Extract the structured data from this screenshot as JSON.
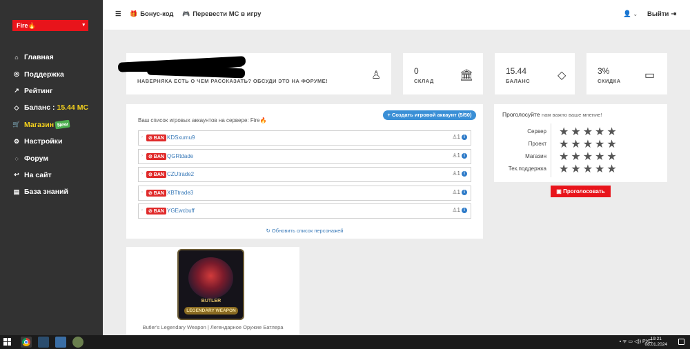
{
  "sidebar": {
    "server": "Fire🔥",
    "items": [
      {
        "icon": "home-icon",
        "glyph": "⌂",
        "label": "Главная"
      },
      {
        "icon": "support-icon",
        "glyph": "◎",
        "label": "Поддержка"
      },
      {
        "icon": "rating-icon",
        "glyph": "↗",
        "label": "Рейтинг"
      },
      {
        "icon": "diamond-icon",
        "glyph": "◇",
        "label": "Баланс :",
        "value": "15.44 МС"
      },
      {
        "icon": "cart-icon",
        "glyph": "🛒",
        "label": "Магазин",
        "badge": "New"
      },
      {
        "icon": "gear-icon",
        "glyph": "⚙",
        "label": "Настройки"
      },
      {
        "icon": "forum-icon",
        "glyph": "◌",
        "label": "Форум"
      },
      {
        "icon": "reply-icon",
        "glyph": "↩",
        "label": "На сайт"
      },
      {
        "icon": "book-icon",
        "glyph": "▤",
        "label": "База знаний"
      }
    ]
  },
  "topbar": {
    "menu_icon": "☰",
    "bonus": "Бонус-код",
    "transfer": "Перевести МС в игру",
    "user_icon": "👤",
    "logout": "Выйти"
  },
  "forum_card": {
    "text": "НАВЕРНЯКА ЕСТЬ О ЧЕМ РАССКАЗАТЬ? ОБСУДИ ЭТО НА ФОРУМЕ!"
  },
  "stats": [
    {
      "value": "0",
      "label": "СКЛАД",
      "icon": "bank-icon",
      "glyph": "🏛"
    },
    {
      "value": "15.44",
      "label": "БАЛАНС",
      "icon": "diamond-icon",
      "glyph": "◇"
    },
    {
      "value": "3%",
      "label": "СКИДКА",
      "icon": "wallet-icon",
      "glyph": "▭"
    }
  ],
  "accounts": {
    "title": "Ваш список игровых аккаунтов на сервере: Fire🔥",
    "create_btn": "+ Создать игровой аккаунт (5/50)",
    "rows": [
      {
        "ban": "⊘ BAN",
        "name": "KDSxumu9",
        "count": "1"
      },
      {
        "ban": "⊘ BAN",
        "name": "QGRtdade",
        "count": "1"
      },
      {
        "ban": "⊘ BAN",
        "name": "CZUtrade2",
        "count": "1"
      },
      {
        "ban": "⊘ BAN",
        "name": "XBTtrade3",
        "count": "1"
      },
      {
        "ban": "⊘ BAN",
        "name": "YGEwcbuff",
        "count": "1"
      }
    ],
    "refresh": "↻ Обновить список персонажей"
  },
  "vote": {
    "title": "Проголосуйте",
    "subtitle": "нам важно ваше мнение!",
    "rows": [
      {
        "label": "Сервер",
        "stars": "★★★★★"
      },
      {
        "label": "Проект",
        "stars": "★★★★★"
      },
      {
        "label": "Магазин",
        "stars": "★★★★★"
      },
      {
        "label": "Тех.поддержка",
        "stars": "★★★★★"
      }
    ],
    "button": "Проголосовать"
  },
  "product": {
    "img_line1": "BUTLER",
    "img_line2": "LEGENDARY WEAPON",
    "caption": "Butler's Legendary Weapon | Легендарное Оружие Батлера"
  },
  "taskbar": {
    "lang": "РУС",
    "time": "19:21",
    "date": "08.01.2024"
  }
}
